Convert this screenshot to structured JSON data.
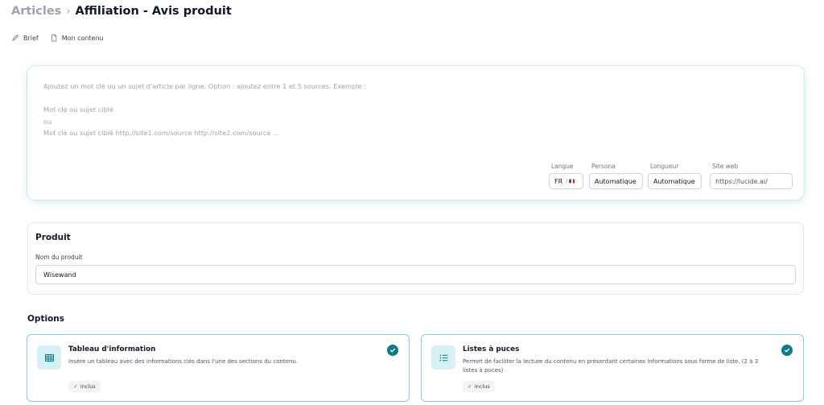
{
  "breadcrumb": {
    "parent": "Articles",
    "separator": "›",
    "current": "Affiliation - Avis produit"
  },
  "subnav": [
    {
      "label": "Brief",
      "icon": "pencil-icon"
    },
    {
      "label": "Mon contenu",
      "icon": "document-icon"
    }
  ],
  "prompt": {
    "placeholder": "Ajoutez un mot clé ou un sujet d'article par ligne. Option : ajoutez entre 1 et 5 sources. Exemple :\n\nMot clé ou sujet ciblé\nou\nMot clé ou sujet ciblé http://site1.com/source http://site2.com/source ..."
  },
  "settings": {
    "language": {
      "label": "Langue",
      "value": "FR",
      "suffix": "/ 🇫🇷"
    },
    "persona": {
      "label": "Persona",
      "value": "Automatique"
    },
    "length": {
      "label": "Longueur",
      "value": "Automatique"
    },
    "website": {
      "label": "Site web",
      "value": "https://lucide.ai/"
    }
  },
  "product": {
    "title": "Produit",
    "field_label": "Nom du produit",
    "field_value": "Wisewand"
  },
  "options": {
    "title": "Options",
    "items": [
      {
        "title": "Tableau d'information",
        "description": "Insère un tableau avec des informations clés dans l'une des sections du contenu.",
        "badge": "Inclus",
        "icon": "table-icon",
        "selected": true
      },
      {
        "title": "Listes à puces",
        "description": "Permet de faciliter la lecture du contenu en présentant certaines informations sous forme de liste. (2 à 3 listes à puces)",
        "badge": "Inclus",
        "icon": "list-icon",
        "selected": true
      }
    ]
  },
  "colors": {
    "accent": "#127a86",
    "accent_light": "#d6f1f6",
    "border_selected": "#7fcfdc"
  }
}
